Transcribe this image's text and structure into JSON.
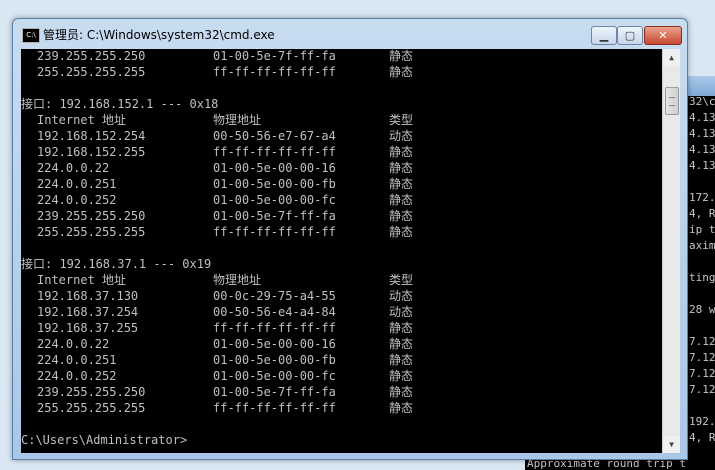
{
  "window": {
    "title": "管理员: C:\\Windows\\system32\\cmd.exe",
    "icon_text": "C:\\",
    "buttons": {
      "minimize": "▁",
      "maximize": "▢",
      "close": "✕"
    }
  },
  "console": {
    "top_rows": [
      {
        "ip": "239.255.255.250",
        "mac": "01-00-5e-7f-ff-fa",
        "type": "静态"
      },
      {
        "ip": "255.255.255.255",
        "mac": "ff-ff-ff-ff-ff-ff",
        "type": "静态"
      }
    ],
    "interfaces": [
      {
        "header": "接口: 192.168.152.1 --- 0x18",
        "col_ip": "Internet 地址",
        "col_mac": "物理地址",
        "col_type": "类型",
        "rows": [
          {
            "ip": "192.168.152.254",
            "mac": "00-50-56-e7-67-a4",
            "type": "动态"
          },
          {
            "ip": "192.168.152.255",
            "mac": "ff-ff-ff-ff-ff-ff",
            "type": "静态"
          },
          {
            "ip": "224.0.0.22",
            "mac": "01-00-5e-00-00-16",
            "type": "静态"
          },
          {
            "ip": "224.0.0.251",
            "mac": "01-00-5e-00-00-fb",
            "type": "静态"
          },
          {
            "ip": "224.0.0.252",
            "mac": "01-00-5e-00-00-fc",
            "type": "静态"
          },
          {
            "ip": "239.255.255.250",
            "mac": "01-00-5e-7f-ff-fa",
            "type": "静态"
          },
          {
            "ip": "255.255.255.255",
            "mac": "ff-ff-ff-ff-ff-ff",
            "type": "静态"
          }
        ]
      },
      {
        "header": "接口: 192.168.37.1 --- 0x19",
        "col_ip": "Internet 地址",
        "col_mac": "物理地址",
        "col_type": "类型",
        "rows": [
          {
            "ip": "192.168.37.130",
            "mac": "00-0c-29-75-a4-55",
            "type": "动态"
          },
          {
            "ip": "192.168.37.254",
            "mac": "00-50-56-e4-a4-84",
            "type": "动态"
          },
          {
            "ip": "192.168.37.255",
            "mac": "ff-ff-ff-ff-ff-ff",
            "type": "静态"
          },
          {
            "ip": "224.0.0.22",
            "mac": "01-00-5e-00-00-16",
            "type": "静态"
          },
          {
            "ip": "224.0.0.251",
            "mac": "01-00-5e-00-00-fb",
            "type": "静态"
          },
          {
            "ip": "224.0.0.252",
            "mac": "01-00-5e-00-00-fc",
            "type": "静态"
          },
          {
            "ip": "239.255.255.250",
            "mac": "01-00-5e-7f-ff-fa",
            "type": "静态"
          },
          {
            "ip": "255.255.255.255",
            "mac": "ff-ff-ff-ff-ff-ff",
            "type": "静态"
          }
        ]
      }
    ],
    "prompt": "C:\\Users\\Administrator>"
  },
  "background_window": {
    "lines": [
      "32\\c",
      "4.13",
      "4.13",
      "4.13",
      "4.13",
      "",
      "172.",
      "4, R",
      "ip t",
      "axim",
      "",
      "ting",
      "",
      "28 w",
      "",
      "7.12",
      "7.12",
      "7.12",
      "7.12",
      "",
      "192.",
      "4, R"
    ],
    "bottom_text": "Approximate round trip t"
  }
}
